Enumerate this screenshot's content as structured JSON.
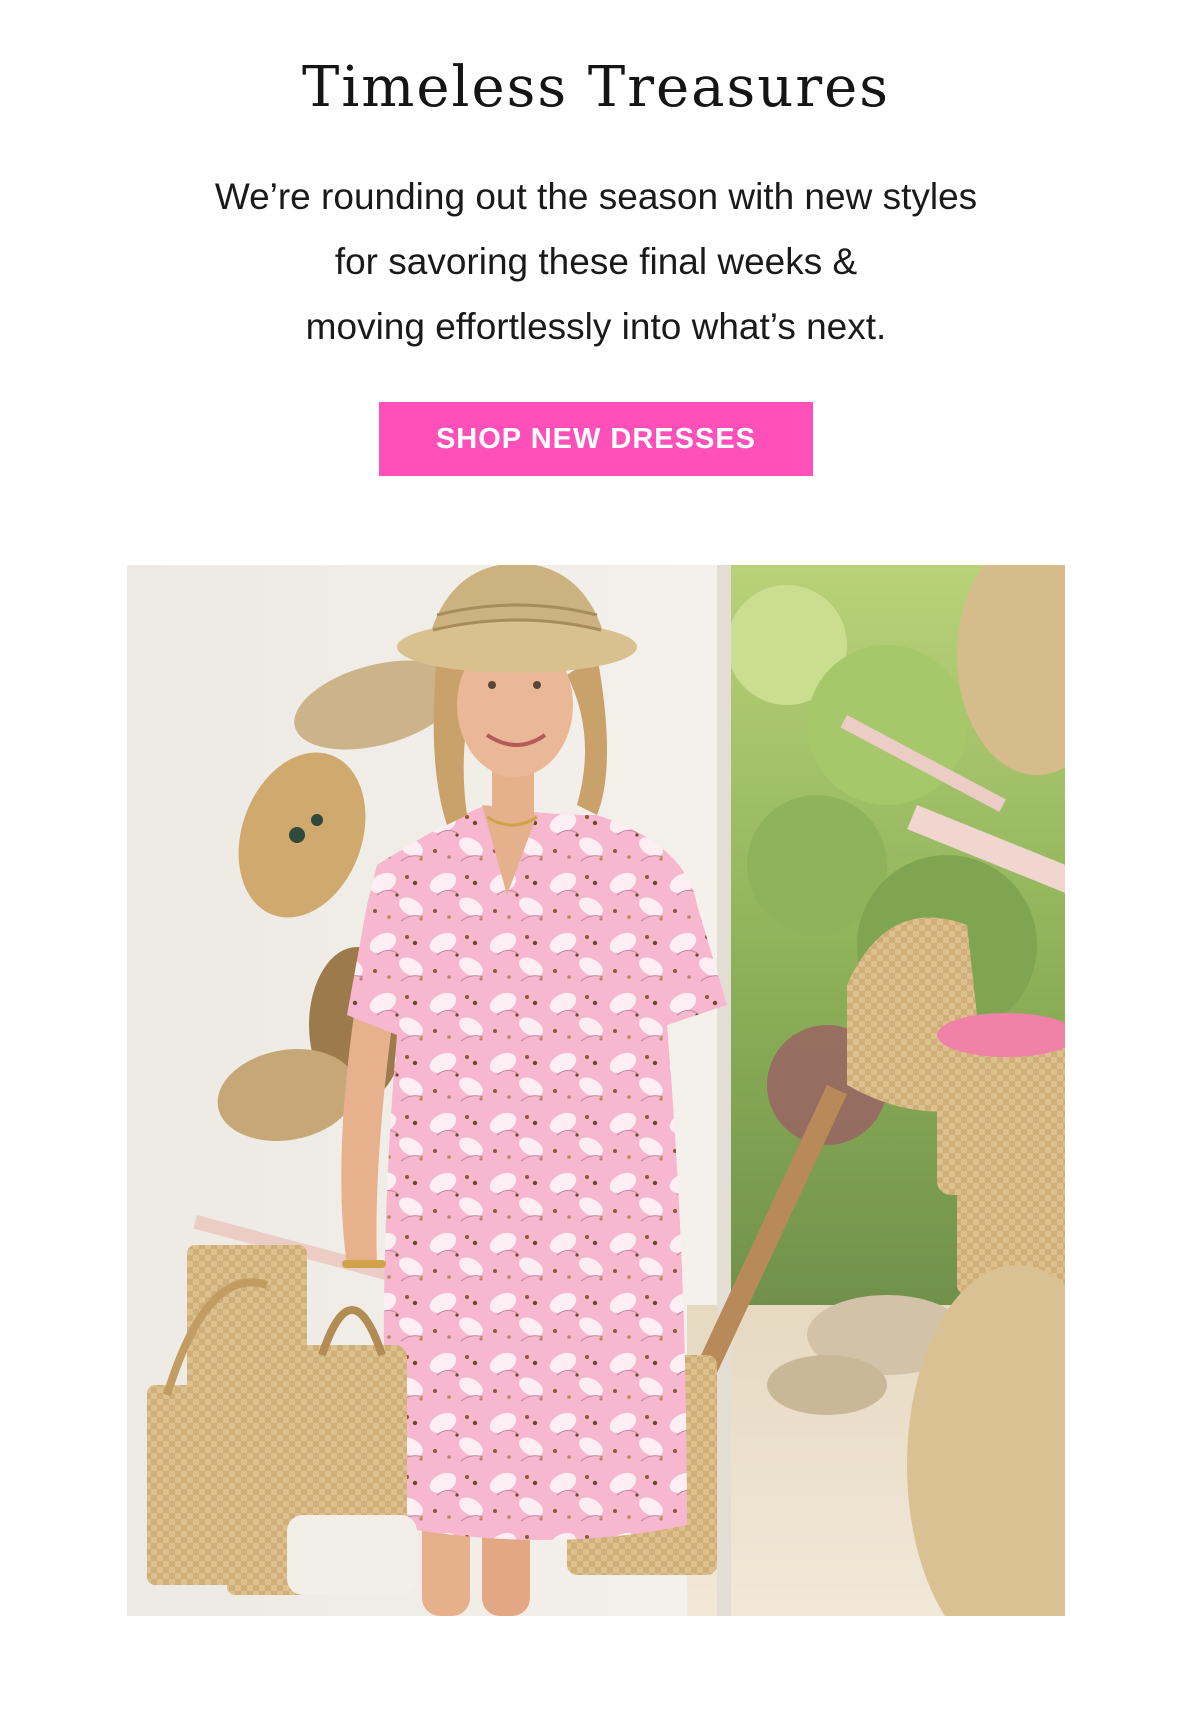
{
  "hero": {
    "title": "Timeless Treasures",
    "body_lines": [
      "We’re rounding out the season with new styles",
      "for savoring these final weeks &",
      "moving effortlessly into what’s next."
    ],
    "cta_label": "SHOP NEW DRESSES"
  },
  "colors": {
    "cta_background": "#ff4fb9",
    "cta_text": "#ffffff",
    "text": "#151515"
  },
  "image": {
    "name": "model-in-pink-floral-dress-photo"
  }
}
